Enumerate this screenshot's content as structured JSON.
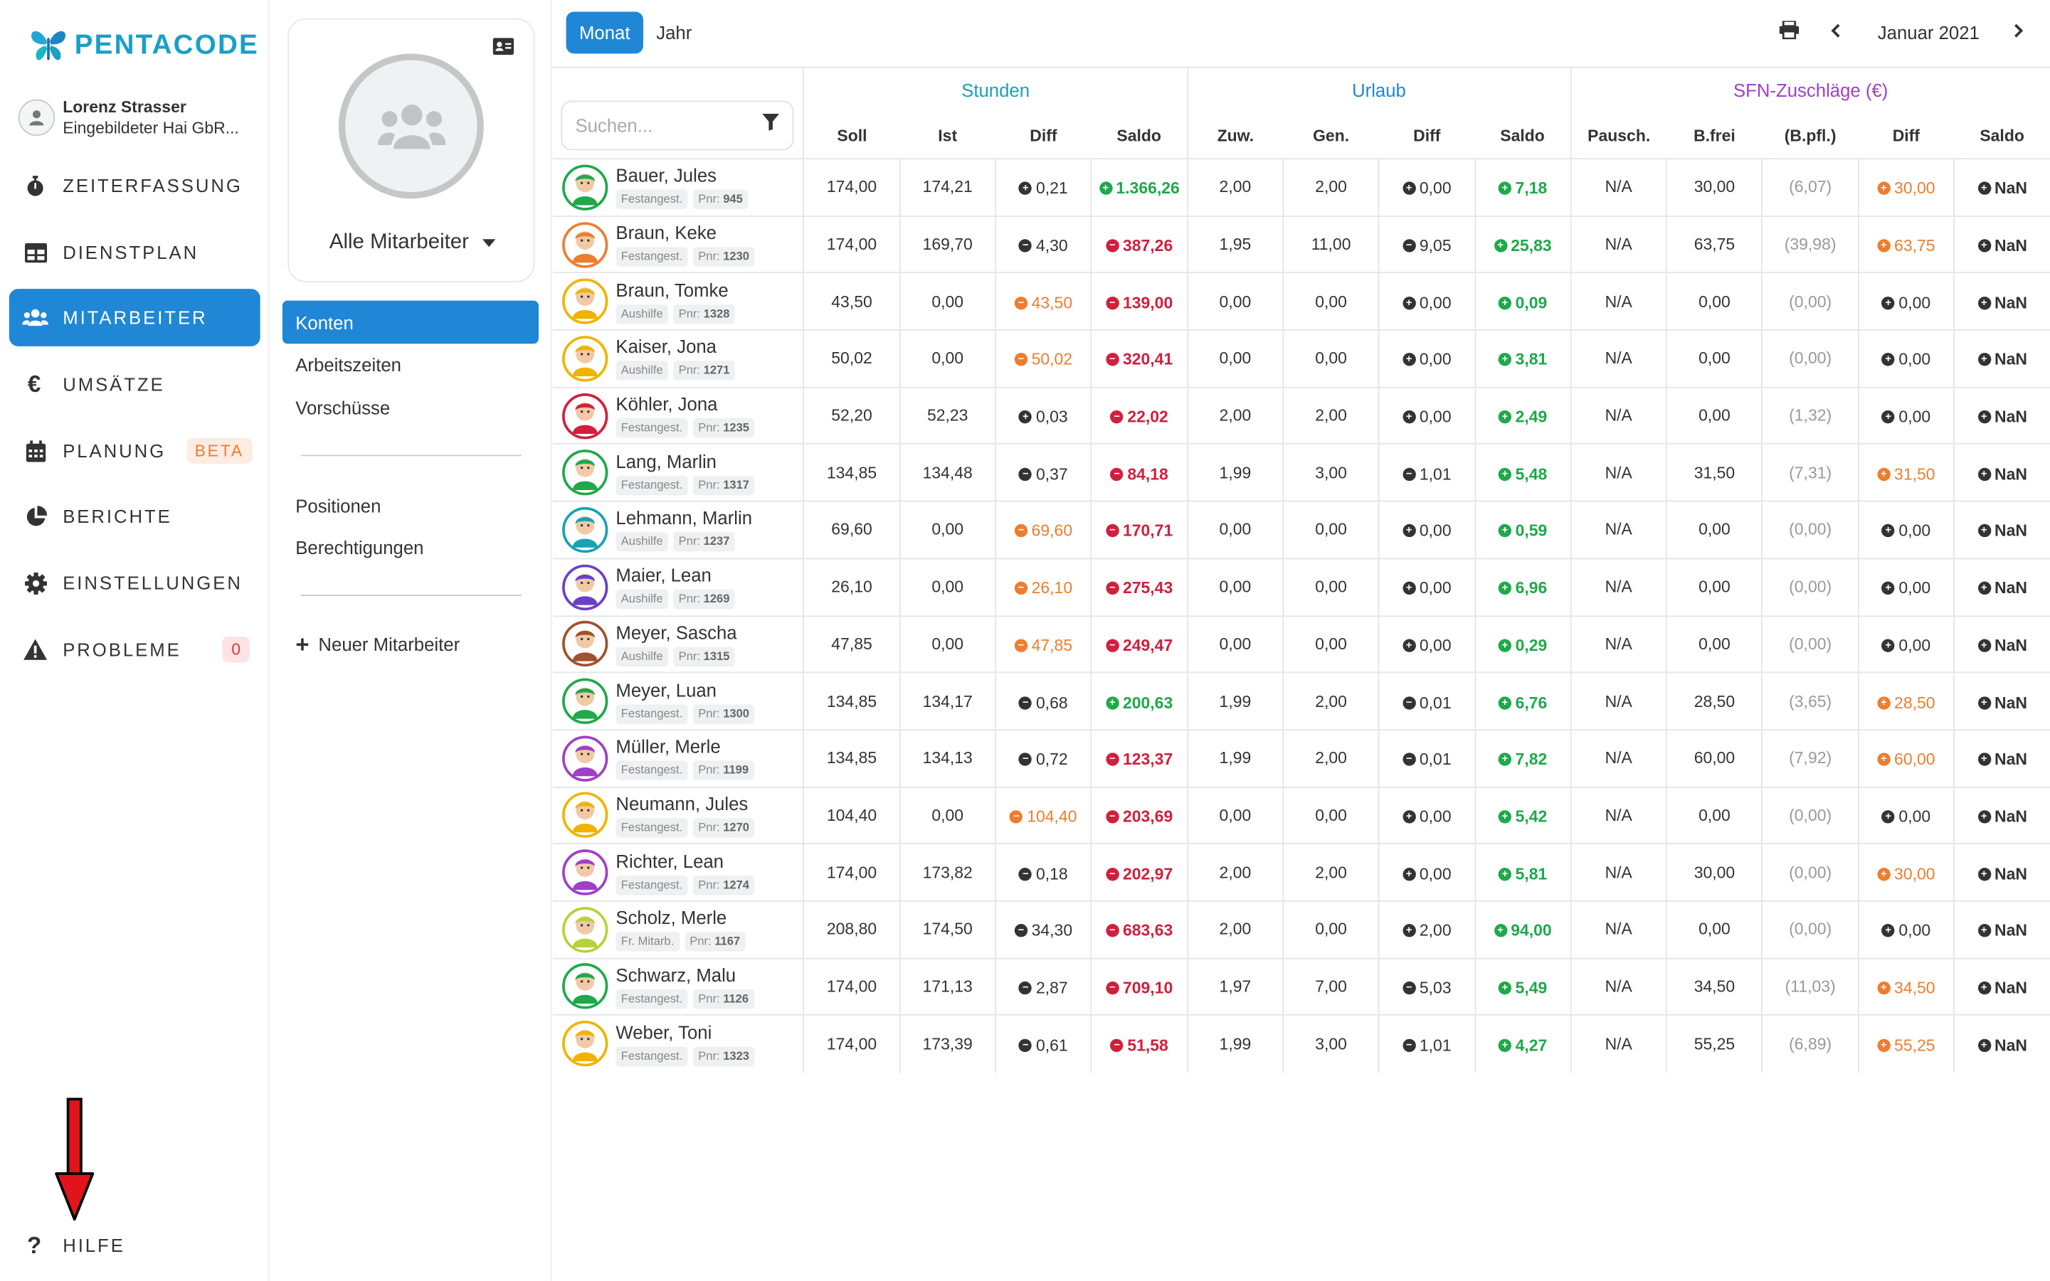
{
  "brand": {
    "name": "PENTACODE"
  },
  "user": {
    "name": "Lorenz Strasser",
    "company": "Eingebildeter Hai GbR..."
  },
  "nav": [
    {
      "label": "ZEITERFASSUNG",
      "icon": "stopwatch-icon"
    },
    {
      "label": "DIENSTPLAN",
      "icon": "table-icon"
    },
    {
      "label": "MITARBEITER",
      "icon": "users-icon",
      "active": true
    },
    {
      "label": "UMSÄTZE",
      "icon": "euro-icon"
    },
    {
      "label": "PLANUNG",
      "icon": "calendar-icon",
      "badge": "BETA"
    },
    {
      "label": "BERICHTE",
      "icon": "pie-chart-icon"
    },
    {
      "label": "EINSTELLUNGEN",
      "icon": "gear-icon"
    },
    {
      "label": "PROBLEME",
      "icon": "warning-icon",
      "count": "0"
    }
  ],
  "help": {
    "label": "HILFE"
  },
  "subnav": {
    "card_title": "Alle Mitarbeiter",
    "items": [
      "Konten",
      "Arbeitszeiten",
      "Vorschüsse"
    ],
    "items2": [
      "Positionen",
      "Berechtigungen"
    ],
    "new_label": "Neuer Mitarbeiter"
  },
  "toolbar": {
    "month_btn": "Monat",
    "year_btn": "Jahr",
    "period": "Januar 2021"
  },
  "search": {
    "placeholder": "Suchen..."
  },
  "groups": {
    "stunden": "Stunden",
    "urlaub": "Urlaub",
    "sfn": "SFN-Zuschläge (€)"
  },
  "columns": [
    "Soll",
    "Ist",
    "Diff",
    "Saldo",
    "Zuw.",
    "Gen.",
    "Diff",
    "Saldo",
    "Pausch.",
    "B.frei",
    "(B.pfl.)",
    "Diff",
    "Saldo"
  ],
  "colors": {
    "accent": "#1f87d6",
    "positive": "#1ea94b",
    "negative": "#d21f3c",
    "warning": "#ee7d2f",
    "stunden": "#18a2b4",
    "sfn": "#9f3fc8"
  },
  "employees": [
    {
      "name": "Bauer, Jules",
      "type": "Festangest.",
      "pnr_label": "Pnr:",
      "pnr": "945",
      "av": "#1ea94b",
      "soll": "174,00",
      "ist": "174,21",
      "diff": "0,21",
      "diff_s": "p",
      "saldo": "1.366,26",
      "saldo_s": "pos",
      "zuw": "2,00",
      "gen": "2,00",
      "udiff": "0,00",
      "udiff_s": "p",
      "usaldo": "7,18",
      "pausch": "N/A",
      "bfrei": "30,00",
      "bpfl": "(6,07)",
      "sdiff": "30,00",
      "sdiff_s": "w",
      "ssaldo": "NaN"
    },
    {
      "name": "Braun, Keke",
      "type": "Festangest.",
      "pnr_label": "Pnr:",
      "pnr": "1230",
      "av": "#ee7d2f",
      "soll": "174,00",
      "ist": "169,70",
      "diff": "4,30",
      "diff_s": "m",
      "saldo": "387,26",
      "saldo_s": "neg",
      "zuw": "1,95",
      "gen": "11,00",
      "udiff": "9,05",
      "udiff_s": "m",
      "usaldo": "25,83",
      "pausch": "N/A",
      "bfrei": "63,75",
      "bpfl": "(39,98)",
      "sdiff": "63,75",
      "sdiff_s": "w",
      "ssaldo": "NaN"
    },
    {
      "name": "Braun, Tomke",
      "type": "Aushilfe",
      "pnr_label": "Pnr:",
      "pnr": "1328",
      "av": "#f0b400",
      "soll": "43,50",
      "ist": "0,00",
      "diff": "43,50",
      "diff_s": "wm",
      "saldo": "139,00",
      "saldo_s": "neg",
      "zuw": "0,00",
      "gen": "0,00",
      "udiff": "0,00",
      "udiff_s": "p",
      "usaldo": "0,09",
      "pausch": "N/A",
      "bfrei": "0,00",
      "bpfl": "(0,00)",
      "sdiff": "0,00",
      "sdiff_s": "p",
      "ssaldo": "NaN"
    },
    {
      "name": "Kaiser, Jona",
      "type": "Aushilfe",
      "pnr_label": "Pnr:",
      "pnr": "1271",
      "av": "#f0b400",
      "soll": "50,02",
      "ist": "0,00",
      "diff": "50,02",
      "diff_s": "wm",
      "saldo": "320,41",
      "saldo_s": "neg",
      "zuw": "0,00",
      "gen": "0,00",
      "udiff": "0,00",
      "udiff_s": "p",
      "usaldo": "3,81",
      "pausch": "N/A",
      "bfrei": "0,00",
      "bpfl": "(0,00)",
      "sdiff": "0,00",
      "sdiff_s": "p",
      "ssaldo": "NaN"
    },
    {
      "name": "Köhler, Jona",
      "type": "Festangest.",
      "pnr_label": "Pnr:",
      "pnr": "1235",
      "av": "#d21f3c",
      "soll": "52,20",
      "ist": "52,23",
      "diff": "0,03",
      "diff_s": "p",
      "saldo": "22,02",
      "saldo_s": "neg",
      "zuw": "2,00",
      "gen": "2,00",
      "udiff": "0,00",
      "udiff_s": "p",
      "usaldo": "2,49",
      "pausch": "N/A",
      "bfrei": "0,00",
      "bpfl": "(1,32)",
      "sdiff": "0,00",
      "sdiff_s": "p",
      "ssaldo": "NaN"
    },
    {
      "name": "Lang, Marlin",
      "type": "Festangest.",
      "pnr_label": "Pnr:",
      "pnr": "1317",
      "av": "#1ea94b",
      "soll": "134,85",
      "ist": "134,48",
      "diff": "0,37",
      "diff_s": "m",
      "saldo": "84,18",
      "saldo_s": "neg",
      "zuw": "1,99",
      "gen": "3,00",
      "udiff": "1,01",
      "udiff_s": "m",
      "usaldo": "5,48",
      "pausch": "N/A",
      "bfrei": "31,50",
      "bpfl": "(7,31)",
      "sdiff": "31,50",
      "sdiff_s": "w",
      "ssaldo": "NaN"
    },
    {
      "name": "Lehmann, Marlin",
      "type": "Aushilfe",
      "pnr_label": "Pnr:",
      "pnr": "1237",
      "av": "#18a2b4",
      "soll": "69,60",
      "ist": "0,00",
      "diff": "69,60",
      "diff_s": "wm",
      "saldo": "170,71",
      "saldo_s": "neg",
      "zuw": "0,00",
      "gen": "0,00",
      "udiff": "0,00",
      "udiff_s": "p",
      "usaldo": "0,59",
      "pausch": "N/A",
      "bfrei": "0,00",
      "bpfl": "(0,00)",
      "sdiff": "0,00",
      "sdiff_s": "p",
      "ssaldo": "NaN"
    },
    {
      "name": "Maier, Lean",
      "type": "Aushilfe",
      "pnr_label": "Pnr:",
      "pnr": "1269",
      "av": "#6a3fc8",
      "soll": "26,10",
      "ist": "0,00",
      "diff": "26,10",
      "diff_s": "wm",
      "saldo": "275,43",
      "saldo_s": "neg",
      "zuw": "0,00",
      "gen": "0,00",
      "udiff": "0,00",
      "udiff_s": "p",
      "usaldo": "6,96",
      "pausch": "N/A",
      "bfrei": "0,00",
      "bpfl": "(0,00)",
      "sdiff": "0,00",
      "sdiff_s": "p",
      "ssaldo": "NaN"
    },
    {
      "name": "Meyer, Sascha",
      "type": "Aushilfe",
      "pnr_label": "Pnr:",
      "pnr": "1315",
      "av": "#a0522d",
      "soll": "47,85",
      "ist": "0,00",
      "diff": "47,85",
      "diff_s": "wm",
      "saldo": "249,47",
      "saldo_s": "neg",
      "zuw": "0,00",
      "gen": "0,00",
      "udiff": "0,00",
      "udiff_s": "p",
      "usaldo": "0,29",
      "pausch": "N/A",
      "bfrei": "0,00",
      "bpfl": "(0,00)",
      "sdiff": "0,00",
      "sdiff_s": "p",
      "ssaldo": "NaN"
    },
    {
      "name": "Meyer, Luan",
      "type": "Festangest.",
      "pnr_label": "Pnr:",
      "pnr": "1300",
      "av": "#1ea94b",
      "soll": "134,85",
      "ist": "134,17",
      "diff": "0,68",
      "diff_s": "m",
      "saldo": "200,63",
      "saldo_s": "pos",
      "zuw": "1,99",
      "gen": "2,00",
      "udiff": "0,01",
      "udiff_s": "m",
      "usaldo": "6,76",
      "pausch": "N/A",
      "bfrei": "28,50",
      "bpfl": "(3,65)",
      "sdiff": "28,50",
      "sdiff_s": "w",
      "ssaldo": "NaN"
    },
    {
      "name": "Müller, Merle",
      "type": "Festangest.",
      "pnr_label": "Pnr:",
      "pnr": "1199",
      "av": "#9f3fc8",
      "soll": "134,85",
      "ist": "134,13",
      "diff": "0,72",
      "diff_s": "m",
      "saldo": "123,37",
      "saldo_s": "neg",
      "zuw": "1,99",
      "gen": "2,00",
      "udiff": "0,01",
      "udiff_s": "m",
      "usaldo": "7,82",
      "pausch": "N/A",
      "bfrei": "60,00",
      "bpfl": "(7,92)",
      "sdiff": "60,00",
      "sdiff_s": "w",
      "ssaldo": "NaN"
    },
    {
      "name": "Neumann, Jules",
      "type": "Festangest.",
      "pnr_label": "Pnr:",
      "pnr": "1270",
      "av": "#f0b400",
      "soll": "104,40",
      "ist": "0,00",
      "diff": "104,40",
      "diff_s": "wm",
      "saldo": "203,69",
      "saldo_s": "neg",
      "zuw": "0,00",
      "gen": "0,00",
      "udiff": "0,00",
      "udiff_s": "p",
      "usaldo": "5,42",
      "pausch": "N/A",
      "bfrei": "0,00",
      "bpfl": "(0,00)",
      "sdiff": "0,00",
      "sdiff_s": "p",
      "ssaldo": "NaN"
    },
    {
      "name": "Richter, Lean",
      "type": "Festangest.",
      "pnr_label": "Pnr:",
      "pnr": "1274",
      "av": "#9f3fc8",
      "soll": "174,00",
      "ist": "173,82",
      "diff": "0,18",
      "diff_s": "m",
      "saldo": "202,97",
      "saldo_s": "neg",
      "zuw": "2,00",
      "gen": "2,00",
      "udiff": "0,00",
      "udiff_s": "p",
      "usaldo": "5,81",
      "pausch": "N/A",
      "bfrei": "30,00",
      "bpfl": "(0,00)",
      "sdiff": "30,00",
      "sdiff_s": "w",
      "ssaldo": "NaN"
    },
    {
      "name": "Scholz, Merle",
      "type": "Fr. Mitarb.",
      "pnr_label": "Pnr:",
      "pnr": "1167",
      "av": "#b6d23a",
      "soll": "208,80",
      "ist": "174,50",
      "diff": "34,30",
      "diff_s": "m",
      "saldo": "683,63",
      "saldo_s": "neg",
      "zuw": "2,00",
      "gen": "0,00",
      "udiff": "2,00",
      "udiff_s": "p",
      "usaldo": "94,00",
      "pausch": "N/A",
      "bfrei": "0,00",
      "bpfl": "(0,00)",
      "sdiff": "0,00",
      "sdiff_s": "p",
      "ssaldo": "NaN"
    },
    {
      "name": "Schwarz, Malu",
      "type": "Festangest.",
      "pnr_label": "Pnr:",
      "pnr": "1126",
      "av": "#1ea94b",
      "soll": "174,00",
      "ist": "171,13",
      "diff": "2,87",
      "diff_s": "m",
      "saldo": "709,10",
      "saldo_s": "neg",
      "zuw": "1,97",
      "gen": "7,00",
      "udiff": "5,03",
      "udiff_s": "m",
      "usaldo": "5,49",
      "pausch": "N/A",
      "bfrei": "34,50",
      "bpfl": "(11,03)",
      "sdiff": "34,50",
      "sdiff_s": "w",
      "ssaldo": "NaN"
    },
    {
      "name": "Weber, Toni",
      "type": "Festangest.",
      "pnr_label": "Pnr:",
      "pnr": "1323",
      "av": "#f0b400",
      "soll": "174,00",
      "ist": "173,39",
      "diff": "0,61",
      "diff_s": "m",
      "saldo": "51,58",
      "saldo_s": "neg",
      "zuw": "1,99",
      "gen": "3,00",
      "udiff": "1,01",
      "udiff_s": "m",
      "usaldo": "4,27",
      "pausch": "N/A",
      "bfrei": "55,25",
      "bpfl": "(6,89)",
      "sdiff": "55,25",
      "sdiff_s": "w",
      "ssaldo": "NaN"
    }
  ]
}
